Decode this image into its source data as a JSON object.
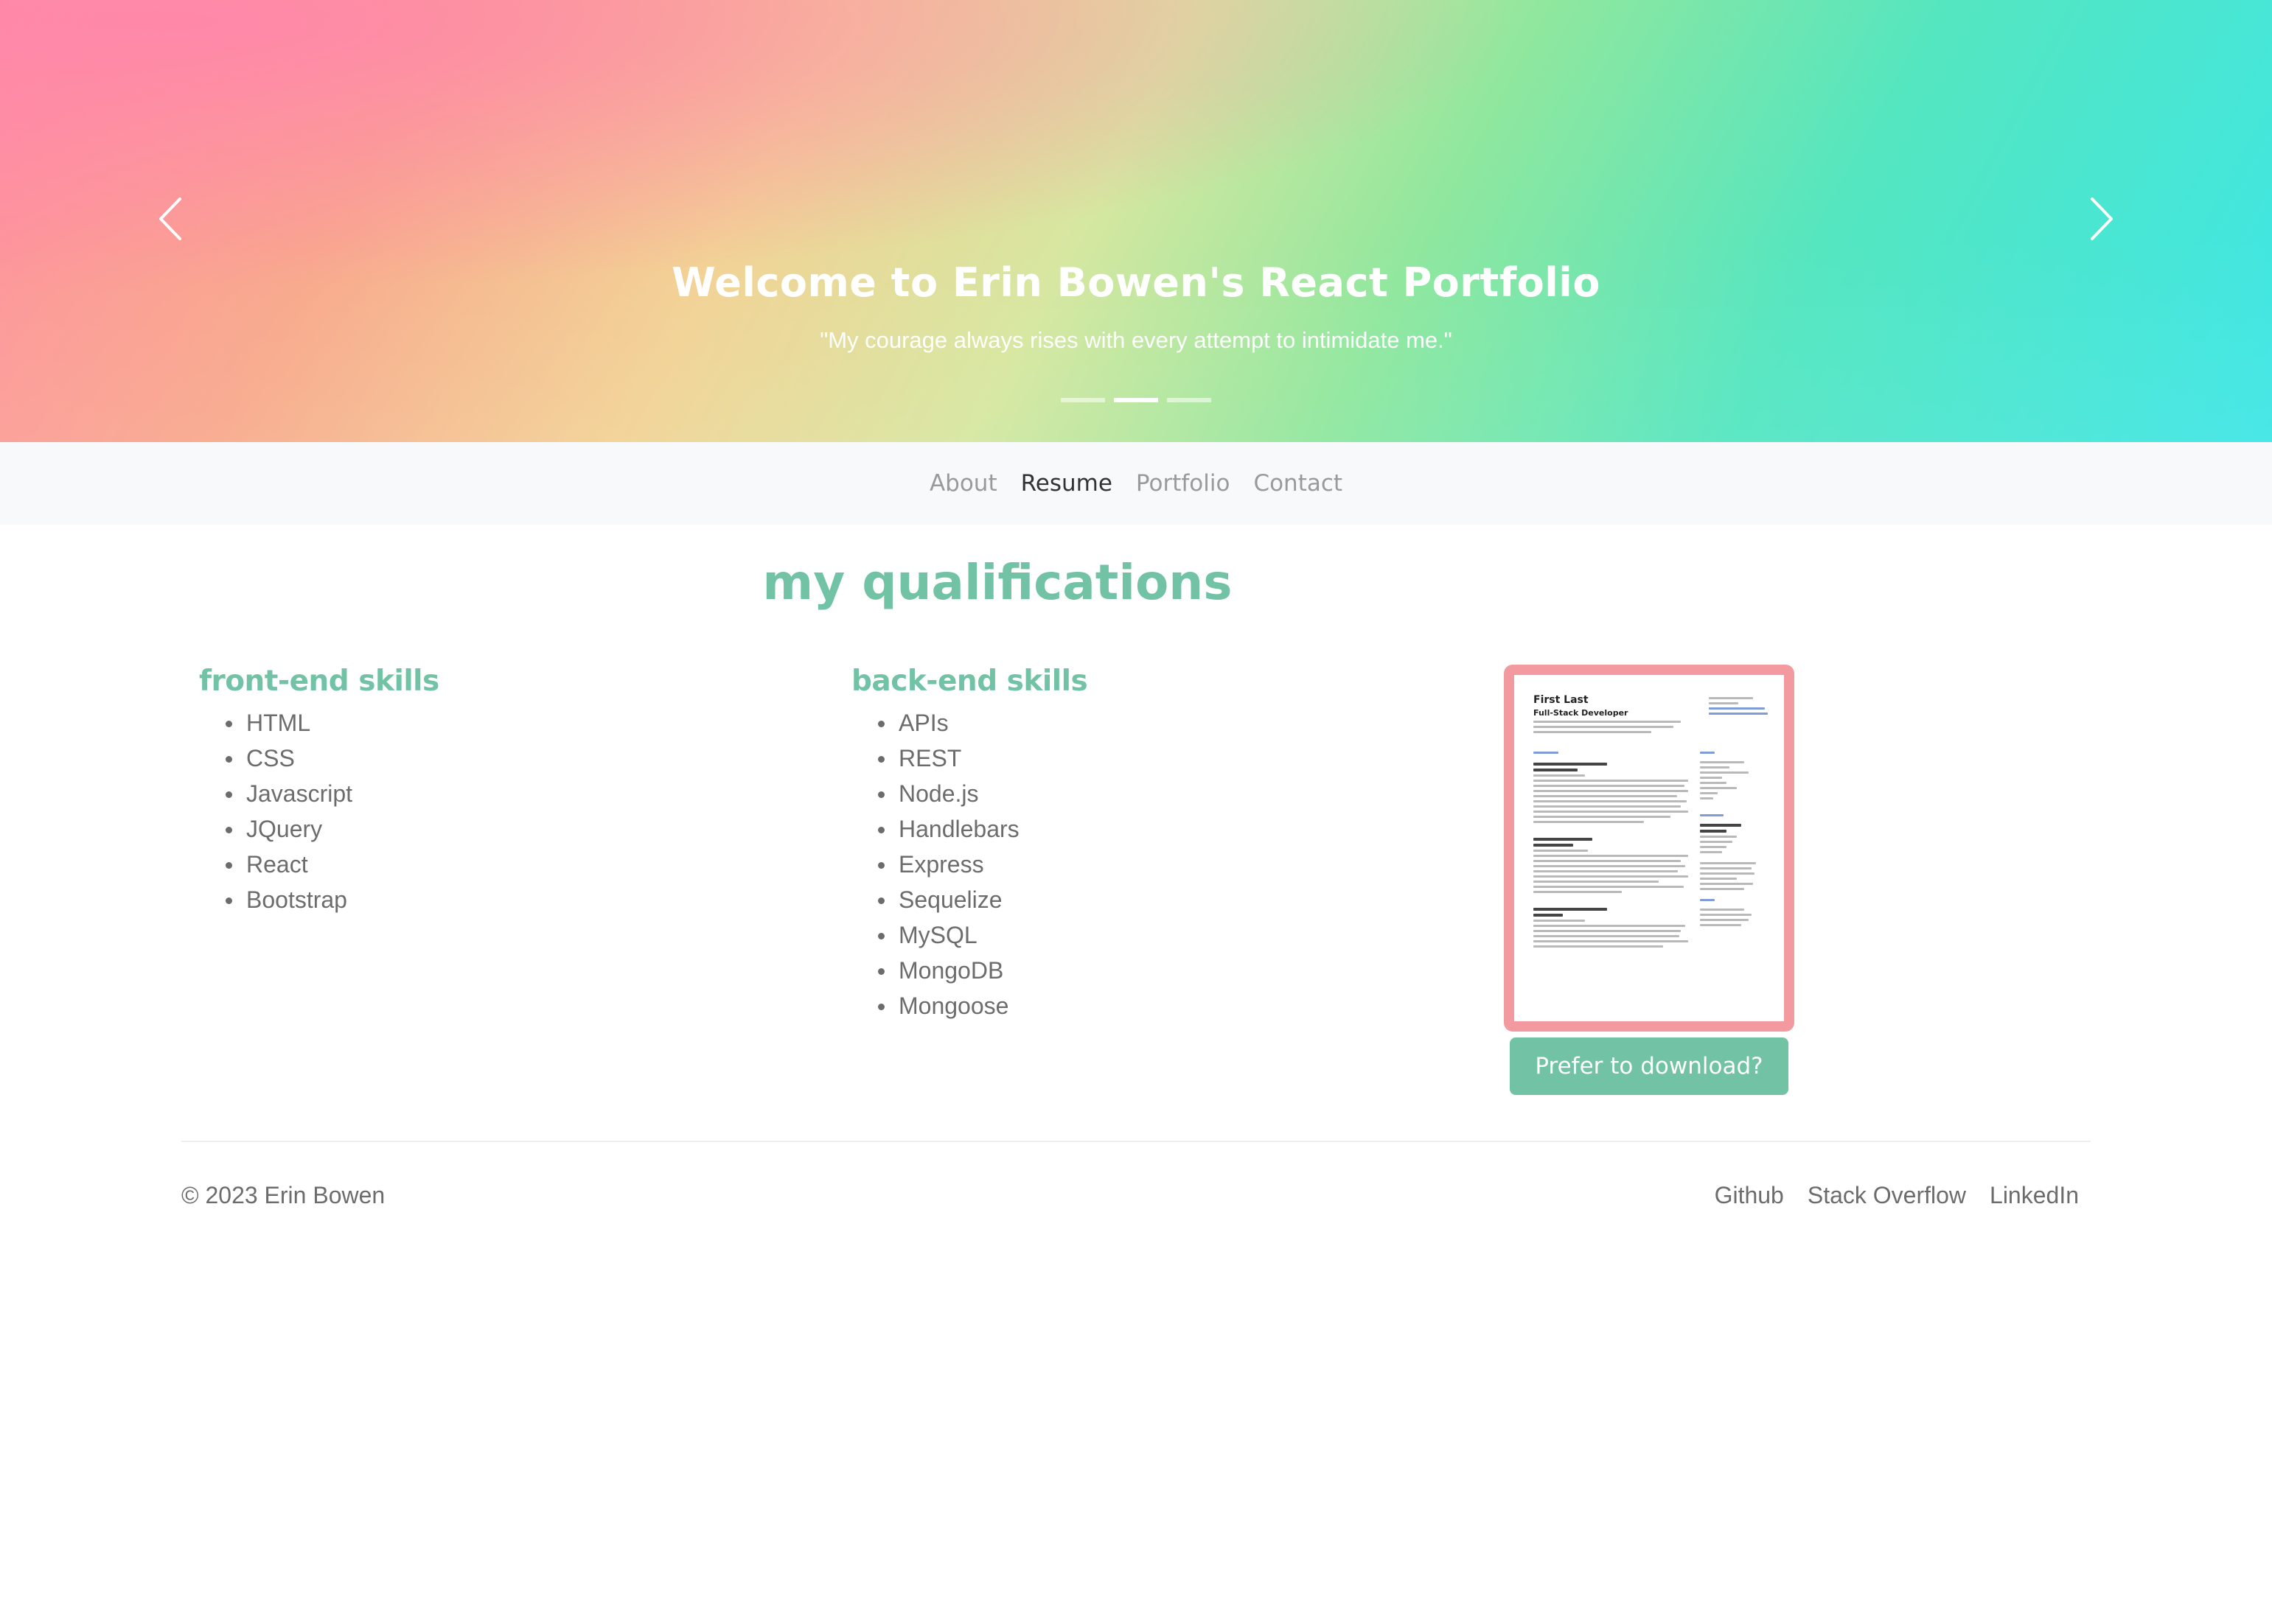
{
  "hero": {
    "title": "Welcome to Erin Bowen's React Portfolio",
    "quote": "\"My courage always rises with every attempt to intimidate me.\"",
    "prev_icon": "chevron-left-icon",
    "next_icon": "chevron-right-icon",
    "slide_count": 3,
    "active_slide": 2
  },
  "nav": {
    "items": [
      {
        "label": "About",
        "active": false
      },
      {
        "label": "Resume",
        "active": true
      },
      {
        "label": "Portfolio",
        "active": false
      },
      {
        "label": "Contact",
        "active": false
      }
    ]
  },
  "main": {
    "title": "my qualifications",
    "front_end": {
      "heading": "front-end skills",
      "items": [
        "HTML",
        "CSS",
        "Javascript",
        "JQuery",
        "React",
        "Bootstrap"
      ]
    },
    "back_end": {
      "heading": "back-end skills",
      "items": [
        "APIs",
        "REST",
        "Node.js",
        "Handlebars",
        "Express",
        "Sequelize",
        "MySQL",
        "MongoDB",
        "Mongoose"
      ]
    },
    "resume_preview": {
      "name": "First Last",
      "role": "Full-Stack Developer"
    },
    "download_label": "Prefer to download?"
  },
  "footer": {
    "copyright": "© 2023 Erin Bowen",
    "links": [
      "Github",
      "Stack Overflow",
      "LinkedIn"
    ]
  },
  "colors": {
    "accent": "#72c2a6",
    "resume_frame": "#f39aa0",
    "nav_bg": "#f8f9fa"
  }
}
